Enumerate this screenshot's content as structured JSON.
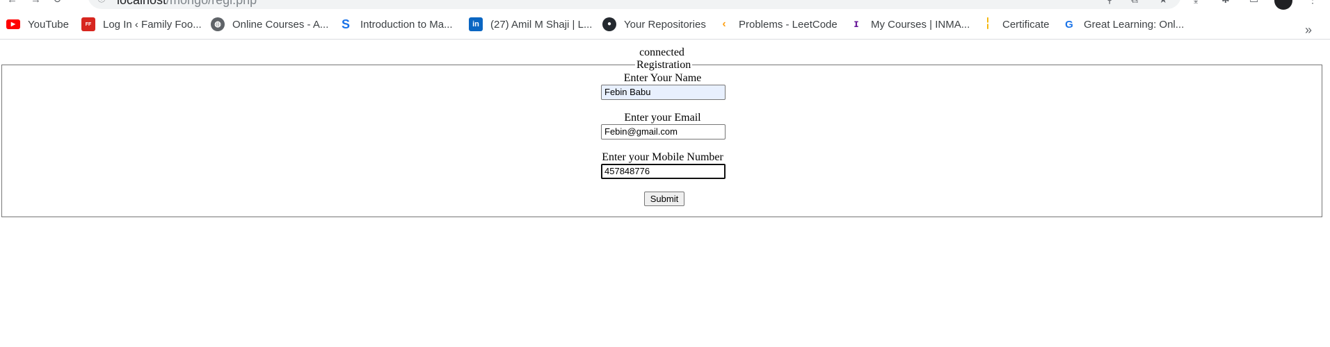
{
  "browser": {
    "url_host": "localhost",
    "url_path": "/mongo/regi.php",
    "bookmarks": [
      {
        "label": "YouTube",
        "icon": "youtube-icon",
        "color": "#ff0000"
      },
      {
        "label": "Log In ‹ Family Foo...",
        "icon": "family-food-icon",
        "color": "#d7261f"
      },
      {
        "label": "Online Courses - A...",
        "icon": "globe-icon",
        "color": "#5f6368"
      },
      {
        "label": "Introduction to Ma...",
        "icon": "s-logo-icon",
        "color": "#1a73e8"
      },
      {
        "label": "(27) Amil M Shaji | L...",
        "icon": "linkedin-icon",
        "color": "#0a66c2"
      },
      {
        "label": "Your Repositories",
        "icon": "github-icon",
        "color": "#24292f"
      },
      {
        "label": "Problems - LeetCode",
        "icon": "leetcode-icon",
        "color": "#ffa116"
      },
      {
        "label": "My Courses | INMA...",
        "icon": "inmakes-icon",
        "color": "#6a1b9a"
      },
      {
        "label": "Certificate",
        "icon": "bar-chart-icon",
        "color": "#f4b400"
      },
      {
        "label": "Great Learning: Onl...",
        "icon": "great-learning-icon",
        "color": "#1a73e8"
      }
    ]
  },
  "page": {
    "status": "connected",
    "form": {
      "legend": "Registration",
      "name_label": "Enter Your Name",
      "name_value": "Febin Babu",
      "email_label": "Enter your Email",
      "email_value": "Febin@gmail.com",
      "mobile_label": "Enter your Mobile Number",
      "mobile_value": "457848776",
      "submit_label": "Submit"
    }
  }
}
